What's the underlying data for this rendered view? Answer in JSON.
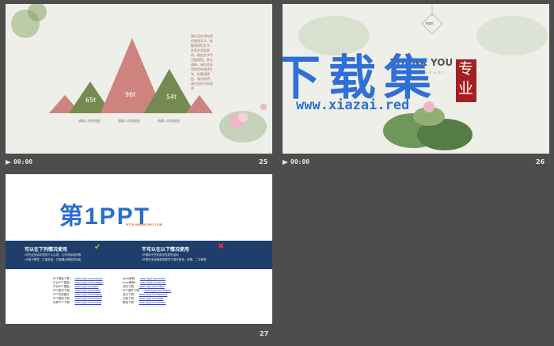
{
  "slides": [
    {
      "number": "25",
      "time": "00:00",
      "triangles": [
        "65t",
        "96t",
        "54t"
      ],
      "captions": [
        "请输入你的描述",
        "请输入你的描述",
        "请输入你的描述"
      ],
      "side_text": "请在此处添加您的描述文字，标题请简短文字，在此处添加说明，描述文字尽可能简短，表达清晰，请在此处添加您的描述文字，标题请简短，描述说明，请在此处添加说明"
    },
    {
      "number": "26",
      "time": "00:00",
      "logo": "logo",
      "thank_you": "THANK YOU",
      "subline": "NIGHT HEART",
      "seal": "专业",
      "watermark_title": "下载集",
      "watermark_url": "www.xiazai.red"
    },
    {
      "number": "27",
      "time": "",
      "brand": "第1PPT",
      "brand_url": "HTTP://WWW.1PPT.COM",
      "can_title": "可以在下列情况使用",
      "can_items": [
        "•可在此处填写您的个人心得，公司内部培训等",
        "•可用于教学，汇报总结，方案展示等相关用途"
      ],
      "cannot_title": "不可以在以下情况使用",
      "cannot_items": [
        "•不得用于任何商业性质的活动",
        "•不得在未经授权的情况下进行售卖、转载、二次销售"
      ],
      "links_left": [
        {
          "label": "PPT模板下载：",
          "url": "www.1ppt.com/moban/"
        },
        {
          "label": "行业PPT模板：",
          "url": "www.1ppt.com/hangye/"
        },
        {
          "label": "节日PPT模板：",
          "url": "www.1ppt.com/jieri/"
        },
        {
          "label": "PPT素材下载：",
          "url": "www.1ppt.com/sucai/"
        },
        {
          "label": "PPT背景图片：",
          "url": "www.1ppt.com/beijing/"
        },
        {
          "label": "PPT图表下载：",
          "url": "www.1ppt.com/tubiao/"
        },
        {
          "label": "优秀PPT下载：",
          "url": "www.1ppt.com/xiazai/"
        }
      ],
      "links_right": [
        {
          "label": "Word教程：",
          "url": "www.1ppt.com/word/"
        },
        {
          "label": "Excel教程：",
          "url": "www.1ppt.com/excel/"
        },
        {
          "label": "资料下载：",
          "url": "www.1ppt.com/ziliao/"
        },
        {
          "label": "PPT课件下载：",
          "url": "www.1ppt.com/kejian/"
        },
        {
          "label": "范文下载：",
          "url": "www.1ppt.com/fanwen/"
        },
        {
          "label": "试卷下载：",
          "url": "www.1ppt.com/shiti/"
        },
        {
          "label": "教案下载：",
          "url": "www.1ppt.com/jiaoan/"
        }
      ]
    }
  ],
  "colors": {
    "pink": "#cf837f",
    "green": "#748a50",
    "blue_band": "#1f3e6b",
    "watermark_blue": "#2f6fd6",
    "seal_red": "#a32020"
  }
}
